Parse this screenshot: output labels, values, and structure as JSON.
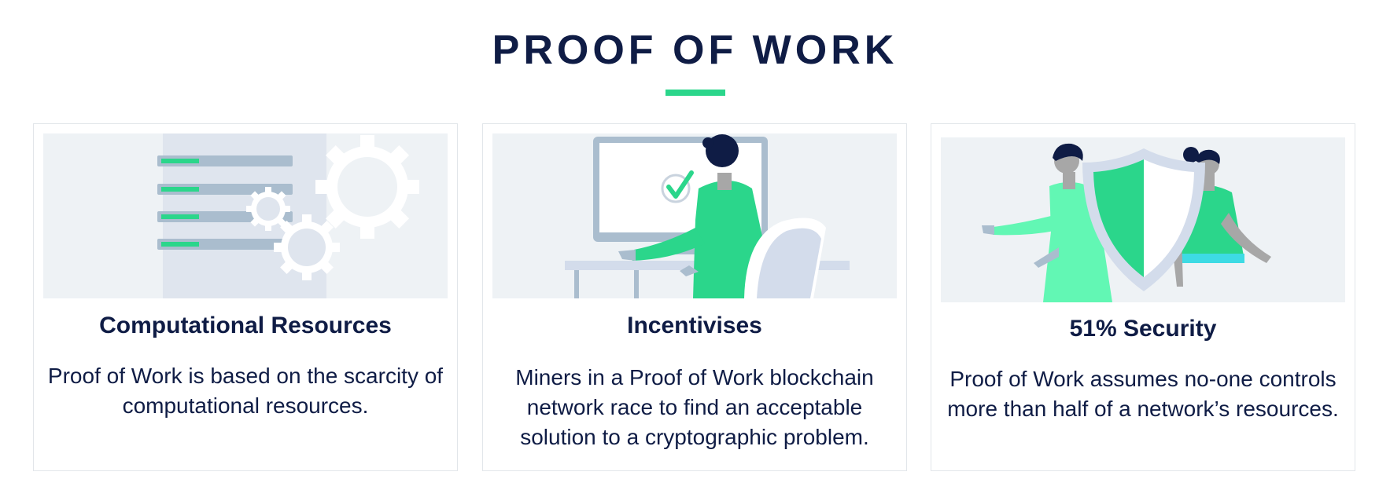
{
  "header": {
    "title": "PROOF OF WORK",
    "accent_color": "#2bd68b",
    "title_color": "#0f1c45"
  },
  "cards": [
    {
      "illustration": "document-with-gears",
      "title": "Computational Resources",
      "text": "Proof of Work is based on the scarcity of computational resources."
    },
    {
      "illustration": "person-at-computer-checkmark",
      "title": "Incentivises",
      "text": "Miners in a Proof of Work blockchain network race to find an acceptable solution to a cryptographic problem."
    },
    {
      "illustration": "people-with-shield",
      "title": "51% Security",
      "text": "Proof of Work assumes no-one controls more than half of a network’s resources."
    }
  ]
}
